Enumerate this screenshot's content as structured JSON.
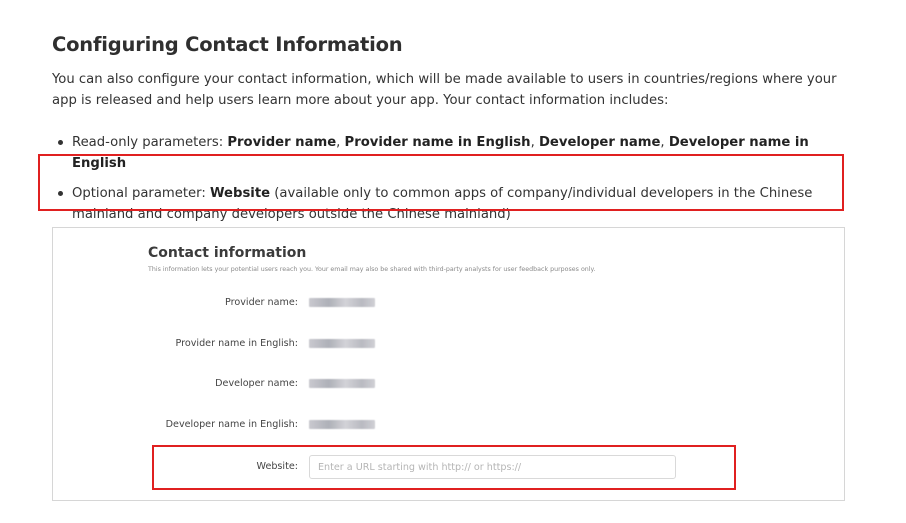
{
  "heading": "Configuring Contact Information",
  "intro": "You can also configure your contact information, which will be made available to users in countries/regions where your app is released and help users learn more about your app. Your contact information includes:",
  "bullets": [
    {
      "prefix": "Read-only parameters: ",
      "bold_1": "Provider name",
      "sep_1": ", ",
      "bold_2": "Provider name in English",
      "sep_2": ", ",
      "bold_3": "Developer name",
      "sep_3": ", ",
      "bold_4": "Developer name in English"
    },
    {
      "prefix": "Optional parameter: ",
      "bold_1": "Website",
      "rest": " (available only to common apps of company/individual developers in the Chinese mainland and company developers outside the Chinese mainland)"
    }
  ],
  "panel": {
    "title": "Contact information",
    "subtitle": "This information lets your potential users reach you. Your email may also be shared with third-party analysts for user feedback purposes only.",
    "fields": [
      {
        "label": "Provider name:"
      },
      {
        "label": "Provider name in English:"
      },
      {
        "label": "Developer name:"
      },
      {
        "label": "Developer name in English:"
      }
    ],
    "website": {
      "label": "Website:",
      "value": "",
      "placeholder": "Enter a URL starting with http:// or https://"
    }
  },
  "colors": {
    "highlight": "#e02020",
    "panel_border": "#d6d6d6",
    "text": "#333333"
  }
}
